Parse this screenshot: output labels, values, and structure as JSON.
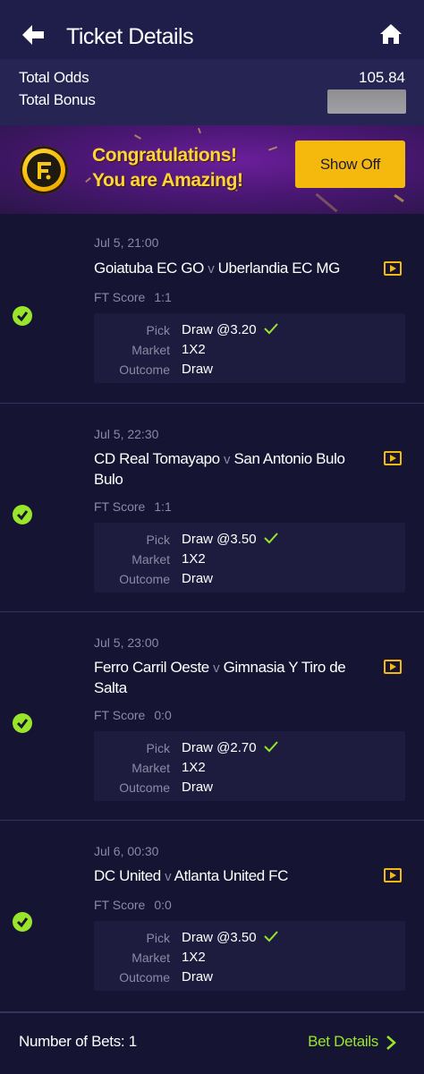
{
  "header": {
    "title": "Ticket Details",
    "back_icon": "back-arrow-icon",
    "home_icon": "home-icon"
  },
  "summary": {
    "total_odds_label": "Total Odds",
    "total_odds_value": "105.84",
    "total_bonus_label": "Total Bonus"
  },
  "banner": {
    "line1": "Congratulations!",
    "line2": "You are Amazing!",
    "button": "Show Off"
  },
  "bets": [
    {
      "date": "Jul 5, 21:00",
      "home": "Goiatuba EC GO",
      "vs": "v",
      "away": "Uberlandia EC MG",
      "ft_label": "FT Score",
      "ft_score": "1:1",
      "pick_label": "Pick",
      "pick": "Draw @3.20",
      "market_label": "Market",
      "market": "1X2",
      "outcome_label": "Outcome",
      "outcome": "Draw"
    },
    {
      "date": "Jul 5, 22:30",
      "home": "CD Real Tomayapo",
      "vs": "v",
      "away": "San Antonio Bulo Bulo",
      "ft_label": "FT Score",
      "ft_score": "1:1",
      "pick_label": "Pick",
      "pick": "Draw @3.50",
      "market_label": "Market",
      "market": "1X2",
      "outcome_label": "Outcome",
      "outcome": "Draw"
    },
    {
      "date": "Jul 5, 23:00",
      "home": "Ferro Carril Oeste",
      "vs": "v",
      "away": "Gimnasia Y Tiro de Salta",
      "ft_label": "FT Score",
      "ft_score": "0:0",
      "pick_label": "Pick",
      "pick": "Draw @2.70",
      "market_label": "Market",
      "market": "1X2",
      "outcome_label": "Outcome",
      "outcome": "Draw"
    },
    {
      "date": "Jul 6, 00:30",
      "home": "DC United",
      "vs": "v",
      "away": "Atlanta United FC",
      "ft_label": "FT Score",
      "ft_score": "0:0",
      "pick_label": "Pick",
      "pick": "Draw @3.50",
      "market_label": "Market",
      "market": "1X2",
      "outcome_label": "Outcome",
      "outcome": "Draw"
    }
  ],
  "footer": {
    "num_bets_label": "Number of Bets: 1",
    "bet_details": "Bet Details"
  },
  "colors": {
    "accent_green": "#98e52b",
    "accent_yellow": "#f5b80d",
    "background": "#151432"
  }
}
